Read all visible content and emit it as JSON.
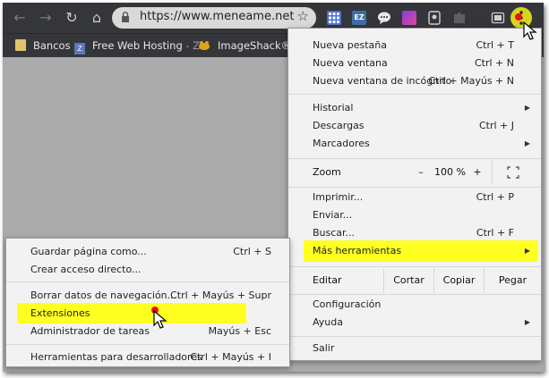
{
  "toolbar": {
    "url": "https://www.meneame.net",
    "icons": [
      "back-icon",
      "forward-icon",
      "reload-icon",
      "home-icon",
      "lock-icon",
      "star-icon",
      "menu-icon"
    ]
  },
  "bookmarks": [
    {
      "label": "Bancos"
    },
    {
      "label": "Free Web Hosting",
      "suffix": " - Z"
    },
    {
      "label": "ImageShack® - I"
    }
  ],
  "extension_badge": "EZ",
  "menu": {
    "nueva_pestana": {
      "label": "Nueva pestaña",
      "shortcut": "Ctrl + T"
    },
    "nueva_ventana": {
      "label": "Nueva ventana",
      "shortcut": "Ctrl + N"
    },
    "incognito": {
      "label": "Nueva ventana de incógnito",
      "shortcut": "Ctrl + Mayús + N"
    },
    "historial": {
      "label": "Historial"
    },
    "descargas": {
      "label": "Descargas",
      "shortcut": "Ctrl + J"
    },
    "marcadores": {
      "label": "Marcadores"
    },
    "zoom": {
      "label": "Zoom",
      "minus": "–",
      "value": "100 %",
      "plus": "+"
    },
    "imprimir": {
      "label": "Imprimir...",
      "shortcut": "Ctrl + P"
    },
    "enviar": {
      "label": "Enviar..."
    },
    "buscar": {
      "label": "Buscar...",
      "shortcut": "Ctrl + F"
    },
    "mas_herramientas": {
      "label": "Más herramientas"
    },
    "editar": {
      "label": "Editar",
      "cortar": "Cortar",
      "copiar": "Copiar",
      "pegar": "Pegar"
    },
    "configuracion": {
      "label": "Configuración"
    },
    "ayuda": {
      "label": "Ayuda"
    },
    "salir": {
      "label": "Salir"
    }
  },
  "submenu": {
    "guardar": {
      "label": "Guardar página como...",
      "shortcut": "Ctrl + S"
    },
    "acceso": {
      "label": "Crear acceso directo..."
    },
    "borrar": {
      "label": "Borrar datos de navegación...",
      "shortcut": "Ctrl + Mayús + Supr"
    },
    "extensiones": {
      "label": "Extensiones"
    },
    "tareas": {
      "label": "Administrador de tareas",
      "shortcut": "Mayús + Esc"
    },
    "devtools": {
      "label": "Herramientas para desarrolladores",
      "shortcut": "Ctrl + Mayús + I"
    }
  },
  "colors": {
    "toolbar_bg": "#35363a",
    "highlight": "#ffff21",
    "menu_bg": "#f2f2f2",
    "page_bg": "#ababab",
    "pointer_mark": "#ee1111"
  }
}
